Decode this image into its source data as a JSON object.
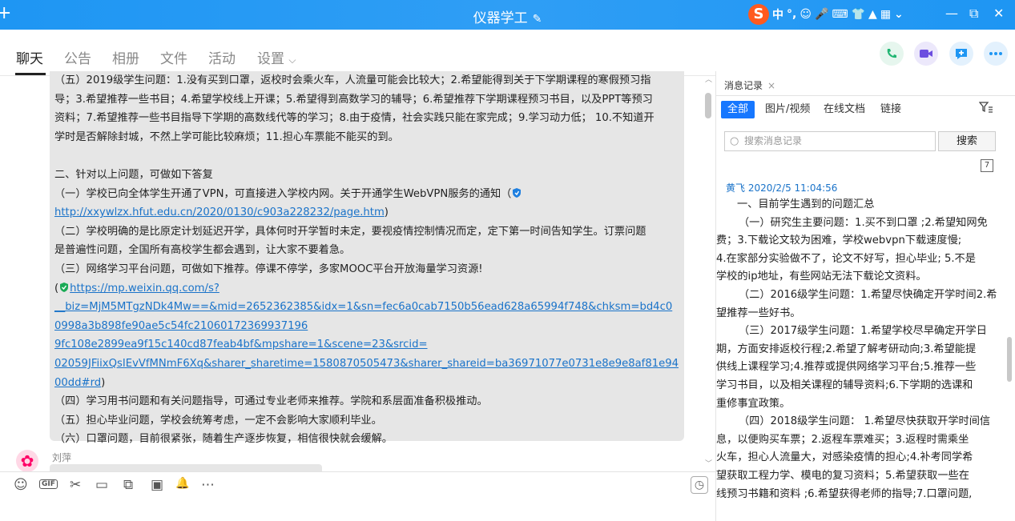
{
  "window": {
    "plus": "+",
    "title": "仪器学工",
    "edit_icon": "✎",
    "ime": {
      "logo": "S",
      "items": [
        "中",
        "°,",
        "☺",
        "🎤",
        "⌨",
        "👕",
        "▲",
        "▦",
        "⌄"
      ]
    },
    "controls": {
      "minimize": "—",
      "restore": "⧉",
      "close": "✕"
    }
  },
  "nav": {
    "tabs": [
      "聊天",
      "公告",
      "相册",
      "文件",
      "活动",
      "设置"
    ],
    "settings_chevron": "⌵",
    "actions": [
      "phone-icon",
      "video-icon",
      "add-chat-icon",
      "more-icon"
    ]
  },
  "chat": {
    "lines": [
      "（五）2019级学生问题：1.没有买到口罩，返校时会乘火车，人流量可能会比较大；2.希望能得到关于下学期课程的寒假预习指",
      "导；3.希望推荐一些书目；4.希望学校线上开课；5.希望得到高数学习的辅导；6.希望推荐下学期课程预习书目，以及PPT等预习",
      "资料；7.希望推荐一些书目指导下学期的高数线代等的学习；8.由于疫情，社会实践只能在家完成；9.学习动力低； 10.不知道开",
      "学时是否解除封城，不然上学可能比较麻烦；11.担心车票能不能买的到。"
    ],
    "section2_title": "二、针对以上问题，可做如下答复",
    "a1_text": "（一）学校已向全体学生开通了VPN，可直接进入学校内网。关于开通学生WebVPN服务的通知（",
    "a1_link": "http://xxywlzx.hfut.edu.cn/2020/0130/c903a228232/page.htm",
    "a1_close": ")",
    "a2_lines": [
      "（二）学校明确的是比原定计划延迟开学，具体何时开学暂时未定，要视疫情控制情况而定，定下第一时间告知学生。订票问题",
      "是普遍性问题，全国所有高校学生都会遇到，让大家不要着急。"
    ],
    "a3_text": "（三）网络学习平台问题，可做如下推荐。停课不停学，多家MOOC平台开放海量学习资源!",
    "a3_open": "(",
    "a3_link_lines": [
      "https://mp.weixin.qq.com/s?",
      "__biz=MjM5MTgzNDk4Mw==&mid=2652362385&idx=1&sn=fec6a0cab7150b56ead628a65994f748&chksm=bd4c0",
      "0998a3b898fe90ae5c54fc21060172369937196 9fc108e2899ea9f15c140cd87feab4bf&mpshare=1&scene=23&srcid=",
      "02059JFiixQsIEvVfMNmF6Xq&sharer_sharetime=1580870505473&sharer_shareid=ba36971077e0731e8e9e8af81e94",
      "00dd#rd"
    ],
    "a3_close": ")",
    "a4": "（四）学习用书问题和有关问题指导，可通过专业老师来推荐。学院和系层面准备积极推动。",
    "a5": "（五）担心毕业问题，学校会统筹考虑，一定不会影响大家顺利毕业。",
    "a6": "（六）口罩问题，目前很紧张，随着生产逐步恢复，相信很快就会缓解。",
    "next_sender": "刘萍"
  },
  "toolbar": {
    "tools": [
      "☺",
      "GIF",
      "✂",
      "▭",
      "⧉",
      "▣",
      "🔔",
      "⋯"
    ],
    "history_icon": "◷"
  },
  "history": {
    "tab_label": "消息记录",
    "tab_close": "×",
    "filters": [
      "全部",
      "图片/视频",
      "在线文档",
      "链接"
    ],
    "search_placeholder": "搜索消息记录",
    "search_button": "搜索",
    "calendar_day": "7",
    "message_header": "黄飞 2020/2/5 11:04:56",
    "message_lines": [
      "一、目前学生遇到的问题汇总",
      "（一）研究生主要问题：1.买不到口罩 ;2.希望知网免",
      "费；3.下载论文较为困难，学校webvpn下载速度慢;",
      "4.在家部分实验做不了，论文不好写，担心毕业; 5.不是",
      "学校的ip地址，有些网站无法下载论文资料。",
      "（二）2016级学生问题：1.希望尽快确定开学时间2.希",
      "望推荐一些好书。",
      "（三）2017级学生问题：1.希望学校尽早确定开学日",
      "期，方面安排返校行程;2.希望了解考研动向;3.希望能提",
      "供线上课程学习;4.推荐或提供网络学习平台;5.推荐一些",
      "学习书目，以及相关课程的辅导资料;6.下学期的选课和",
      "重修事宜政策。",
      "（四）2018级学生问题： 1.希望尽快获取开学时间信",
      "息，以便购买车票；2.返程车票难买；3.返程时需乘坐",
      "火车，担心人流量大，对感染疫情的担心;4.补考同学希",
      "望获取工程力学、模电的复习资料；5.希望获取一些在",
      "线预习书籍和资料 ;6.希望获得老师的指导;7.口罩问题,"
    ]
  },
  "colors": {
    "titlebar": "#1e96f3",
    "link": "#1a73c9",
    "accent": "#1677ff",
    "bubble": "#e6e6e6"
  }
}
